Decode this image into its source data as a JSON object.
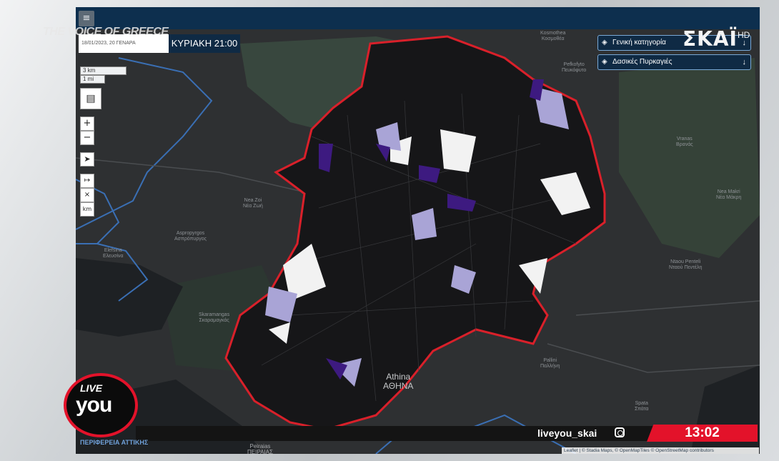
{
  "broadcast": {
    "channel_logo": "ΣΚΑΪ",
    "channel_hd": "HD",
    "promo_title": "THE VOICE OF GREECE",
    "promo_time": "ΚΥΡΙΑΚΗ 21:00",
    "date_strip": "18/01/2023, 20 ΓΕΝΑΡΑ",
    "live_label": "LIVE",
    "show_label": "you",
    "social_handle": "liveyou_skai",
    "clock": "13:02",
    "lower_left_label": "ΠΕΡΙΦΕΡΕΙΑ ΑΤΤΙΚΗΣ"
  },
  "map_ui": {
    "menu_icon": "≡",
    "scale_km": "3 km",
    "scale_mi": "1 mi",
    "zoom_in": "+",
    "zoom_out": "−",
    "measure_icon": "↦",
    "clear_icon": "×",
    "unit_label": "km",
    "layer_select_1": "Γενική κατηγορία",
    "layer_select_2": "Δασικές Πυρκαγιές",
    "arrow_symbol": "↓",
    "attribution": "Leaflet | © Stadia Maps, © OpenMapTiles © OpenStreetMap contributors"
  },
  "places": [
    {
      "name": "Kosmothea\nΚοσμοθέα"
    },
    {
      "name": "Pefkofyto\nΠευκόφυτο"
    },
    {
      "name": "Vranas\nΒρανάς"
    },
    {
      "name": "Nea Makri\nΝέα Μάκρη"
    },
    {
      "name": "Ntaou Penteli\nΝταού Πεντέλη"
    },
    {
      "name": "Nea Zoi\nΝέα Ζωή"
    },
    {
      "name": "Aspropyrgos\nΑσπρόπυργος"
    },
    {
      "name": "Elefsina\nΕλευσίνα"
    },
    {
      "name": "Skaramangas\nΣκαραμαγκάς"
    },
    {
      "name": "Pallini\nΠαλλήνη"
    },
    {
      "name": "Spata\nΣπάτα"
    },
    {
      "name": "Athina\nΑΘΗΝΑ"
    },
    {
      "name": "Peiraias\nΠΕΙΡΑΙΑΣ"
    }
  ],
  "colors": {
    "boundary": "#d9202a",
    "light_purple": "#a9a4d6",
    "dark_purple": "#3d1a80",
    "white_fill": "#f2f2f2",
    "water": "#3a6fb4"
  }
}
